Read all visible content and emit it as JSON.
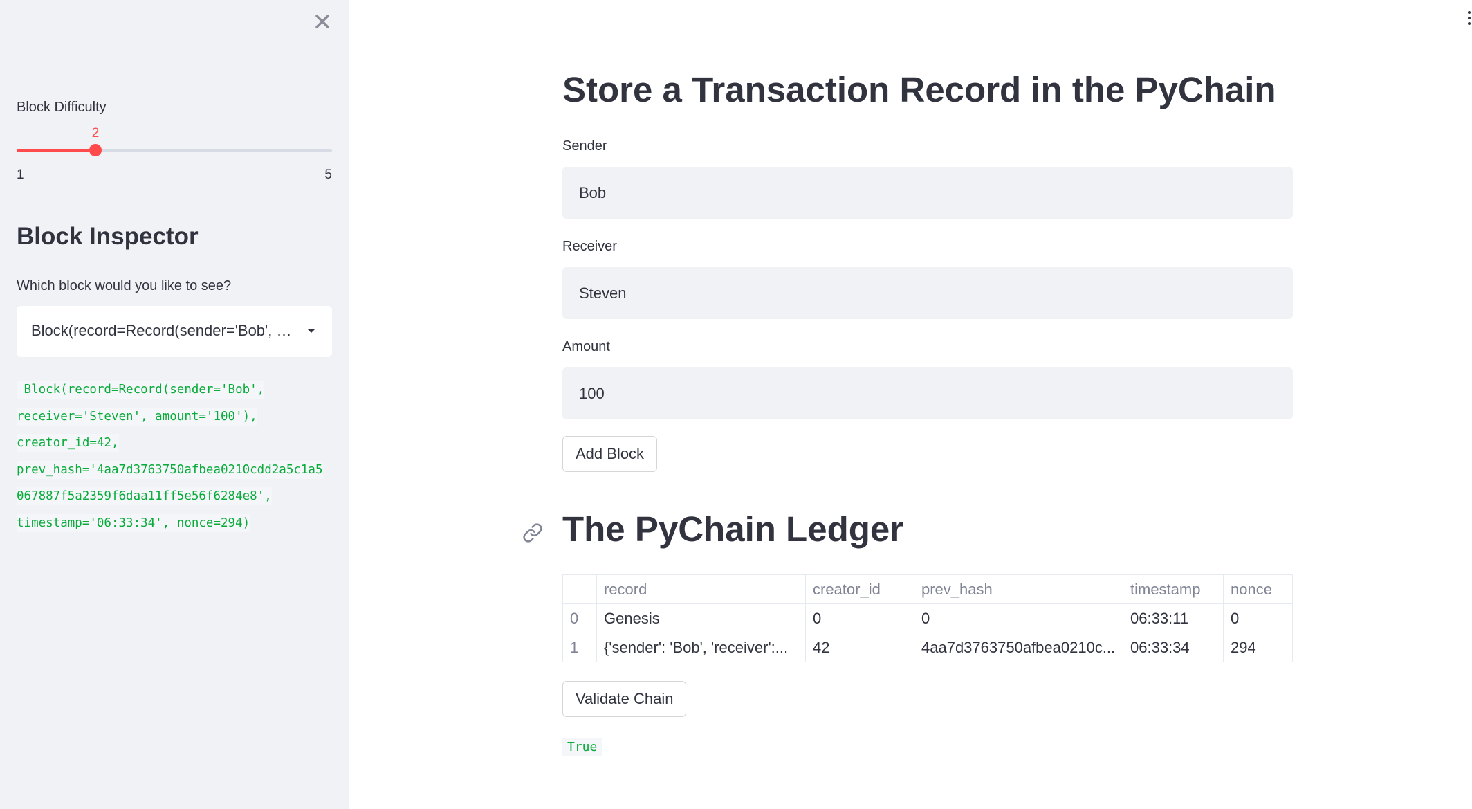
{
  "sidebar": {
    "slider": {
      "label": "Block Difficulty",
      "value": "2",
      "min": "1",
      "max": "5",
      "fraction": 0.25
    },
    "inspector_title": "Block Inspector",
    "select_label": "Which block would you like to see?",
    "select_value": "Block(record=Record(sender='Bob', receiver='Steven', amount='100'), creator_id=42, prev_hash='4aa7d3763750afbea0210cdd2a5c1a5067887f5a2359f6daa11ff5e56f6284e8', timestamp='06:33:34', nonce=294)",
    "code_lines": [
      " Block(record=Record(sender='Bob',",
      "receiver='Steven', amount='100'),",
      "creator_id=42,",
      "prev_hash='4aa7d3763750afbea0210cdd2a5c1a5",
      "067887f5a2359f6daa11ff5e56f6284e8',",
      "timestamp='06:33:34', nonce=294)"
    ]
  },
  "main": {
    "title": "Store a Transaction Record in the PyChain",
    "sender": {
      "label": "Sender",
      "value": "Bob"
    },
    "receiver": {
      "label": "Receiver",
      "value": "Steven"
    },
    "amount": {
      "label": "Amount",
      "value": "100"
    },
    "add_block_label": "Add Block",
    "ledger_title": "The PyChain Ledger",
    "table": {
      "columns": [
        "",
        "record",
        "creator_id",
        "prev_hash",
        "timestamp",
        "nonce"
      ],
      "rows": [
        [
          "0",
          "Genesis",
          "0",
          "0",
          "06:33:11",
          "0"
        ],
        [
          "1",
          "{'sender': 'Bob', 'receiver':...",
          "42",
          "4aa7d3763750afbea0210c...",
          "06:33:34",
          "294"
        ]
      ]
    },
    "validate_label": "Validate Chain",
    "validation_result": "True"
  },
  "colors": {
    "accent": "#ff4b4b",
    "code_green": "#09ab3b",
    "sidebar_bg": "#f0f2f6"
  },
  "icons": {
    "close": "close-icon",
    "anchor": "link-icon",
    "menu": "vertical-dots-icon",
    "caret": "chevron-down-icon"
  }
}
